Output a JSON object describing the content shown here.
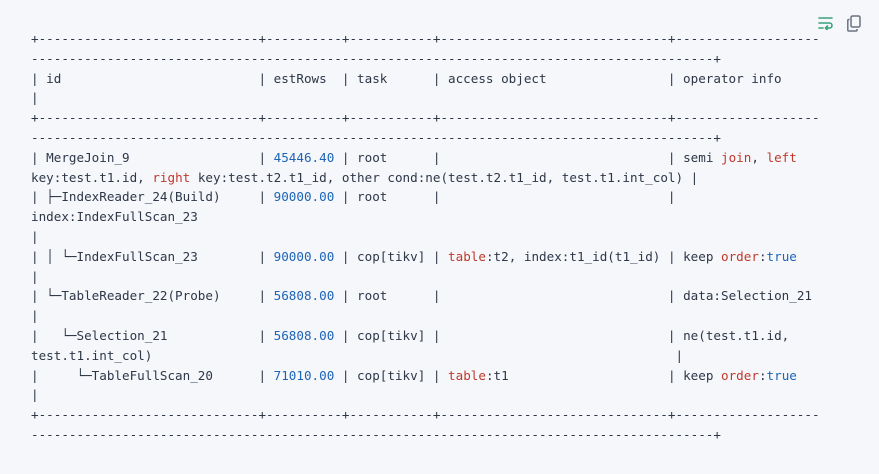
{
  "toolbar": {
    "wrap_icon": "wrap-lines-icon",
    "copy_icon": "copy-icon",
    "accent": "#3aa27a",
    "icon_color": "#6b7280"
  },
  "lines": [
    [
      {
        "t": "+-----------------------------+----------+-----------+------------------------------+-------------------"
      }
    ],
    [
      {
        "t": "------------------------------------------------------------------------------------------+"
      }
    ],
    [
      {
        "t": "| id                          | estRows  | task      | access object                | operator info"
      }
    ],
    [
      {
        "t": "|"
      }
    ],
    [
      {
        "t": "+-----------------------------+----------+-----------+------------------------------+-------------------"
      }
    ],
    [
      {
        "t": "------------------------------------------------------------------------------------------+"
      }
    ],
    [
      {
        "t": "| MergeJoin_9                 | "
      },
      {
        "t": "45446.40",
        "c": "num"
      },
      {
        "t": " | root      |                              | semi "
      },
      {
        "t": "join",
        "c": "kw-red"
      },
      {
        "t": ", "
      },
      {
        "t": "left",
        "c": "kw-red"
      }
    ],
    [
      {
        "t": "key:test.t1.id, "
      },
      {
        "t": "right",
        "c": "kw-red"
      },
      {
        "t": " key:test.t2.t1_id, other cond:ne(test.t2.t1_id, test.t1.int_col) |"
      }
    ],
    [
      {
        "t": "| ├─IndexReader_24(Build)     | "
      },
      {
        "t": "90000.00",
        "c": "num"
      },
      {
        "t": " | root      |                              |"
      }
    ],
    [
      {
        "t": "index:IndexFullScan_23"
      }
    ],
    [
      {
        "t": "|"
      }
    ],
    [
      {
        "t": "| │ └─IndexFullScan_23        | "
      },
      {
        "t": "90000.00",
        "c": "num"
      },
      {
        "t": " | cop[tikv] | "
      },
      {
        "t": "table",
        "c": "kw-red"
      },
      {
        "t": ":t2, index:t1_id(t1_id) | keep "
      },
      {
        "t": "order",
        "c": "kw-red"
      },
      {
        "t": ":"
      },
      {
        "t": "true",
        "c": "kw-blue"
      }
    ],
    [
      {
        "t": "|"
      }
    ],
    [
      {
        "t": "| └─TableReader_22(Probe)     | "
      },
      {
        "t": "56808.00",
        "c": "num"
      },
      {
        "t": " | root      |                              | data:Selection_21"
      }
    ],
    [
      {
        "t": "|"
      }
    ],
    [
      {
        "t": "|   └─Selection_21            | "
      },
      {
        "t": "56808.00",
        "c": "num"
      },
      {
        "t": " | cop[tikv] |                              | ne(test.t1.id,"
      }
    ],
    [
      {
        "t": "test.t1.int_col)                                                                     |"
      }
    ],
    [
      {
        "t": "|     └─TableFullScan_20      | "
      },
      {
        "t": "71010.00",
        "c": "num"
      },
      {
        "t": " | cop[tikv] | "
      },
      {
        "t": "table",
        "c": "kw-red"
      },
      {
        "t": ":t1                     | keep "
      },
      {
        "t": "order",
        "c": "kw-red"
      },
      {
        "t": ":"
      },
      {
        "t": "true",
        "c": "kw-blue"
      }
    ],
    [
      {
        "t": "|"
      }
    ],
    [
      {
        "t": "+-----------------------------+----------+-----------+------------------------------+-------------------"
      }
    ],
    [
      {
        "t": "------------------------------------------------------------------------------------------+"
      }
    ]
  ]
}
